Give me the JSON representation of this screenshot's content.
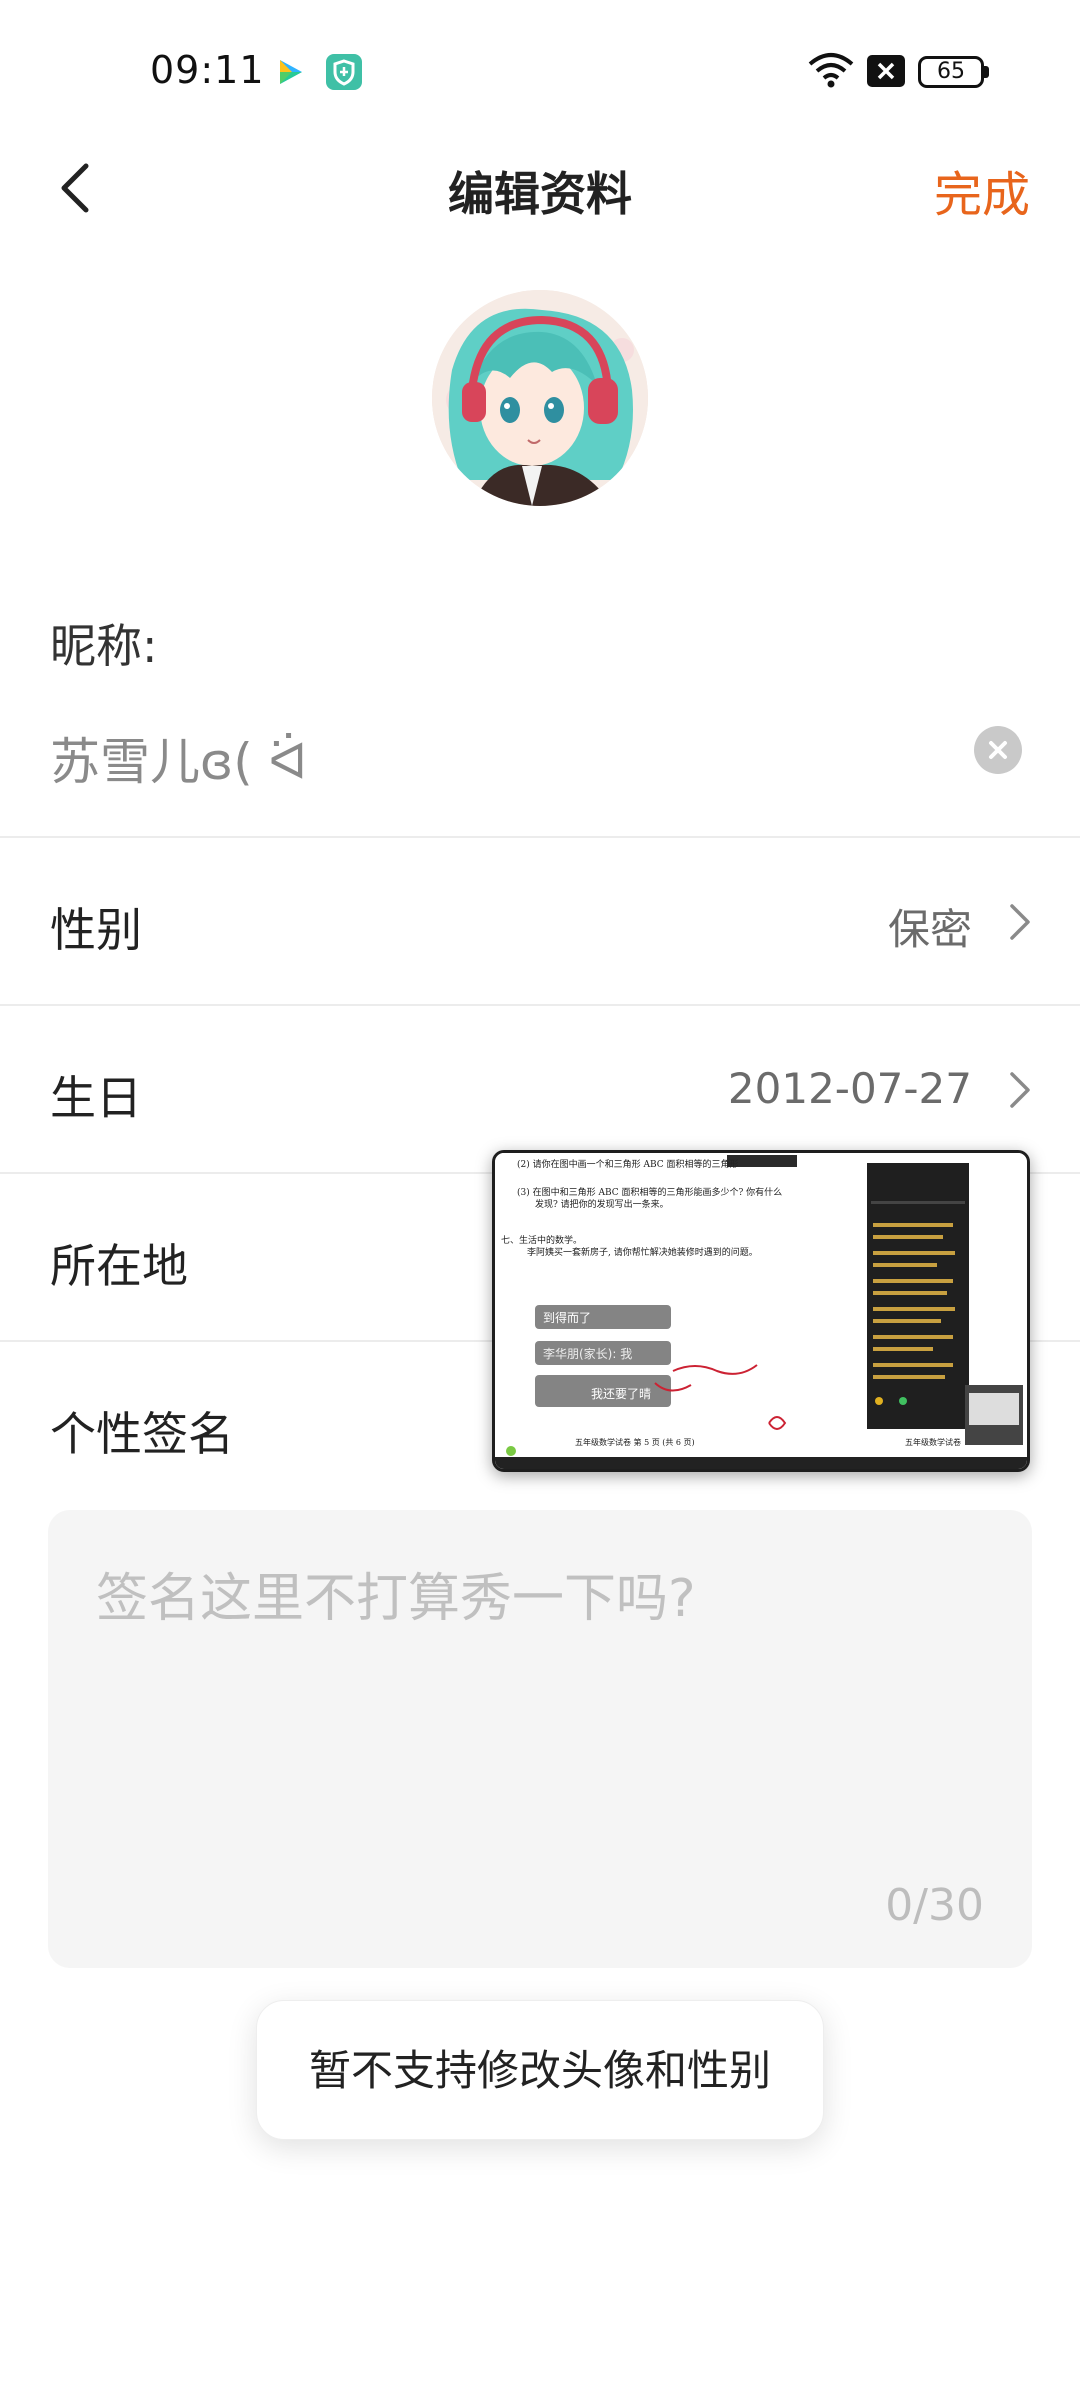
{
  "status_bar": {
    "time": "09:11",
    "battery": "65",
    "icons": [
      "video-app-icon",
      "security-app-icon",
      "wifi-icon",
      "no-sim-icon",
      "battery-icon"
    ]
  },
  "header": {
    "title": "编辑资料",
    "done_label": "完成",
    "accent_color": "#e8651c"
  },
  "nickname": {
    "label": "昵称:",
    "value": "苏雪儿ɞ( ᐛ"
  },
  "rows": [
    {
      "label": "性别",
      "value": "保密"
    },
    {
      "label": "生日",
      "value": "2012-07-27"
    },
    {
      "label": "所在地",
      "value": ""
    }
  ],
  "signature": {
    "label": "个性签名",
    "placeholder": "签名这里不打算秀一下吗?",
    "counter": "0/30"
  },
  "toast": {
    "message": "暂不支持修改头像和性别"
  },
  "floating_window": {
    "lines": [
      "(2) 请你在图中画一个和三角形 ABC 面积相等的三角形",
      "(3) 在图中和三角形 ABC 面积相等的三角形能画多少个? 你有什么",
      "发现? 请把你的发现写出一条来。",
      "七、生活中的数学。",
      "李阿姨买一套新房子, 请你帮忙解决她装修时遇到的问题。",
      "五年级数学试卷    第 5 页    (共 6 页)",
      "五年级数学试卷"
    ],
    "chat_bubbles": [
      "到得而了",
      "李华朋(家长): 我",
      "我还要了晴"
    ]
  }
}
